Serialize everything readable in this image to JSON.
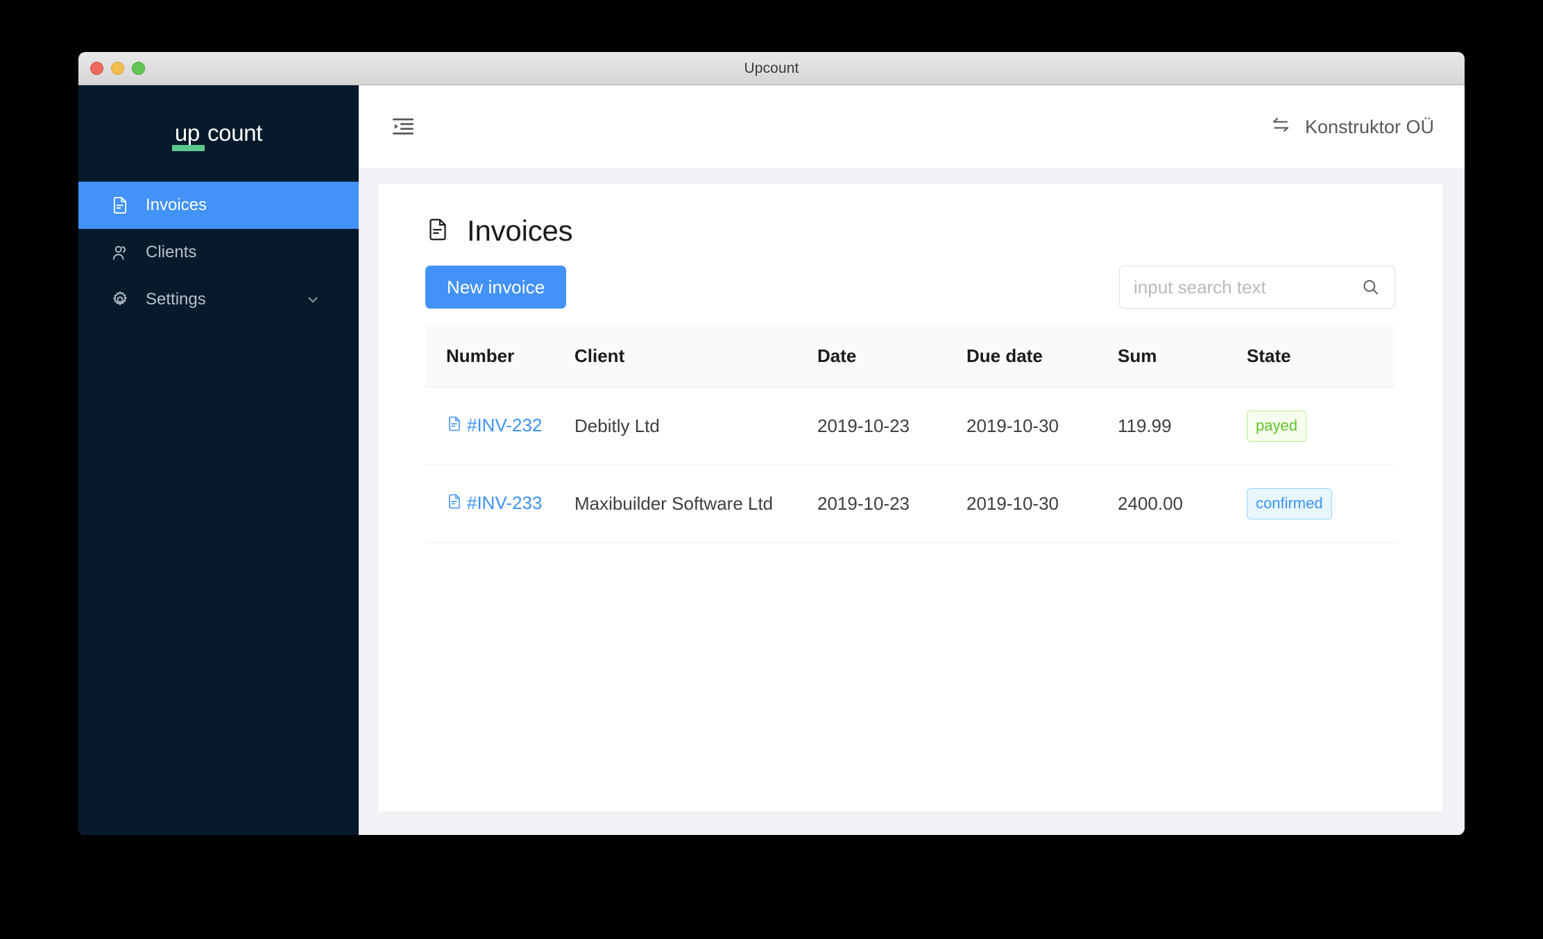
{
  "window": {
    "title": "Upcount",
    "traffic_lights": [
      {
        "name": "close",
        "color": "#ec6a5f"
      },
      {
        "name": "minimize",
        "color": "#f4bd4f"
      },
      {
        "name": "maximize",
        "color": "#61c554"
      }
    ]
  },
  "sidebar": {
    "logo": {
      "part1": "up",
      "part2": "count",
      "accent": "#5cc98e"
    },
    "items": [
      {
        "label": "Invoices",
        "icon": "file-text-icon",
        "active": true
      },
      {
        "label": "Clients",
        "icon": "users-icon",
        "active": false
      },
      {
        "label": "Settings",
        "icon": "gear-icon",
        "active": false,
        "chevron": "chevron-down-icon"
      }
    ],
    "background": "#071a2b",
    "active_background": "#4292f7"
  },
  "topbar": {
    "fold_icon": "menu-fold-icon",
    "tenant": {
      "label": "Konstruktor OÜ",
      "icon": "swap-icon"
    }
  },
  "main": {
    "page_title": "Invoices",
    "page_title_icon": "file-text-icon",
    "new_invoice_label": "New invoice",
    "search": {
      "placeholder": "input search text",
      "value": "",
      "icon": "search-icon"
    },
    "table": {
      "columns": [
        "Number",
        "Client",
        "Date",
        "Due date",
        "Sum",
        "State"
      ],
      "rows": [
        {
          "number": "#INV-232",
          "client": "Debitly Ltd",
          "date": "2019-10-23",
          "due_date": "2019-10-30",
          "sum": "119.99",
          "state": "payed",
          "state_variant": "payed"
        },
        {
          "number": "#INV-233",
          "client": "Maxibuilder Software Ltd",
          "date": "2019-10-23",
          "due_date": "2019-10-30",
          "sum": "2400.00",
          "state": "confirmed",
          "state_variant": "confirmed"
        }
      ]
    }
  },
  "colors": {
    "accent_blue": "#4292f7",
    "link_blue": "#3e93f7",
    "badge_green_text": "#62c229",
    "badge_green_bg": "#f6ffed",
    "badge_blue_text": "#3e93f7",
    "badge_blue_bg": "#e8f6ff",
    "page_background": "#f0f2f5"
  }
}
